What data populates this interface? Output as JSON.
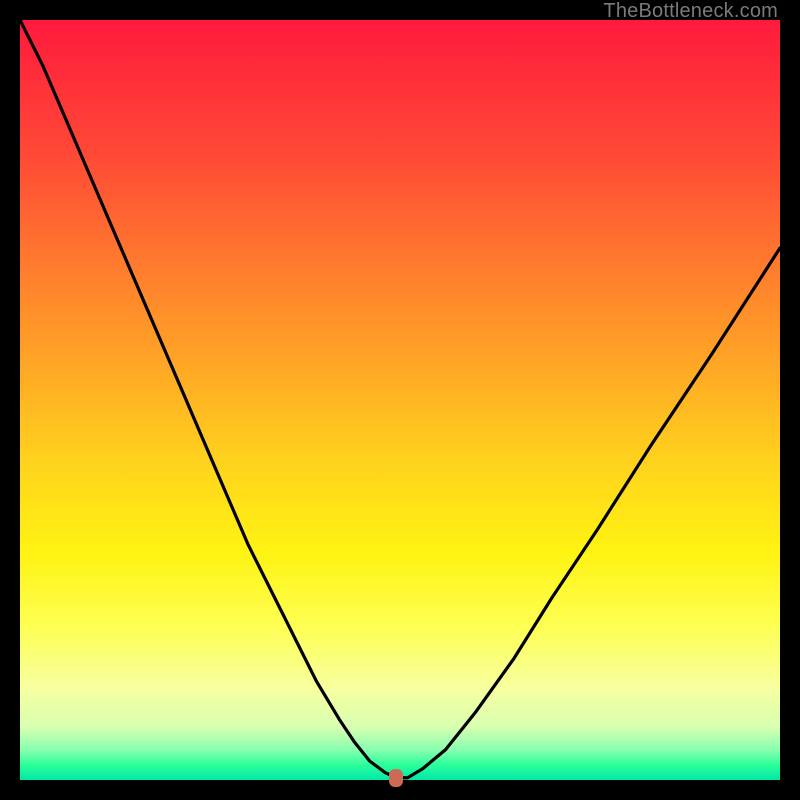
{
  "attribution": "TheBottleneck.com",
  "chart_data": {
    "type": "line",
    "title": "",
    "xlabel": "",
    "ylabel": "",
    "xlim": [
      0,
      100
    ],
    "ylim": [
      0,
      100
    ],
    "grid": false,
    "series": [
      {
        "name": "bottleneck-curve",
        "x": [
          0,
          3,
          6,
          9,
          12,
          15,
          18,
          21,
          24,
          27,
          30,
          33,
          36,
          39,
          42,
          44,
          46,
          48,
          49.5,
          51,
          53,
          56,
          60,
          65,
          70,
          76,
          83,
          91,
          100
        ],
        "values": [
          100,
          94,
          87,
          80,
          73,
          66,
          59,
          52,
          45,
          38,
          31,
          25,
          19,
          13,
          8,
          5,
          2.5,
          1,
          0.3,
          0.3,
          1.5,
          4,
          9,
          16,
          24,
          33,
          44,
          56,
          70
        ]
      }
    ],
    "marker": {
      "x": 49.5,
      "y": 0.3,
      "color": "#cc6a56"
    },
    "background_gradient": {
      "top": "#ff1a3c",
      "mid": "#ffd21d",
      "bottom": "#00e8a8"
    }
  }
}
